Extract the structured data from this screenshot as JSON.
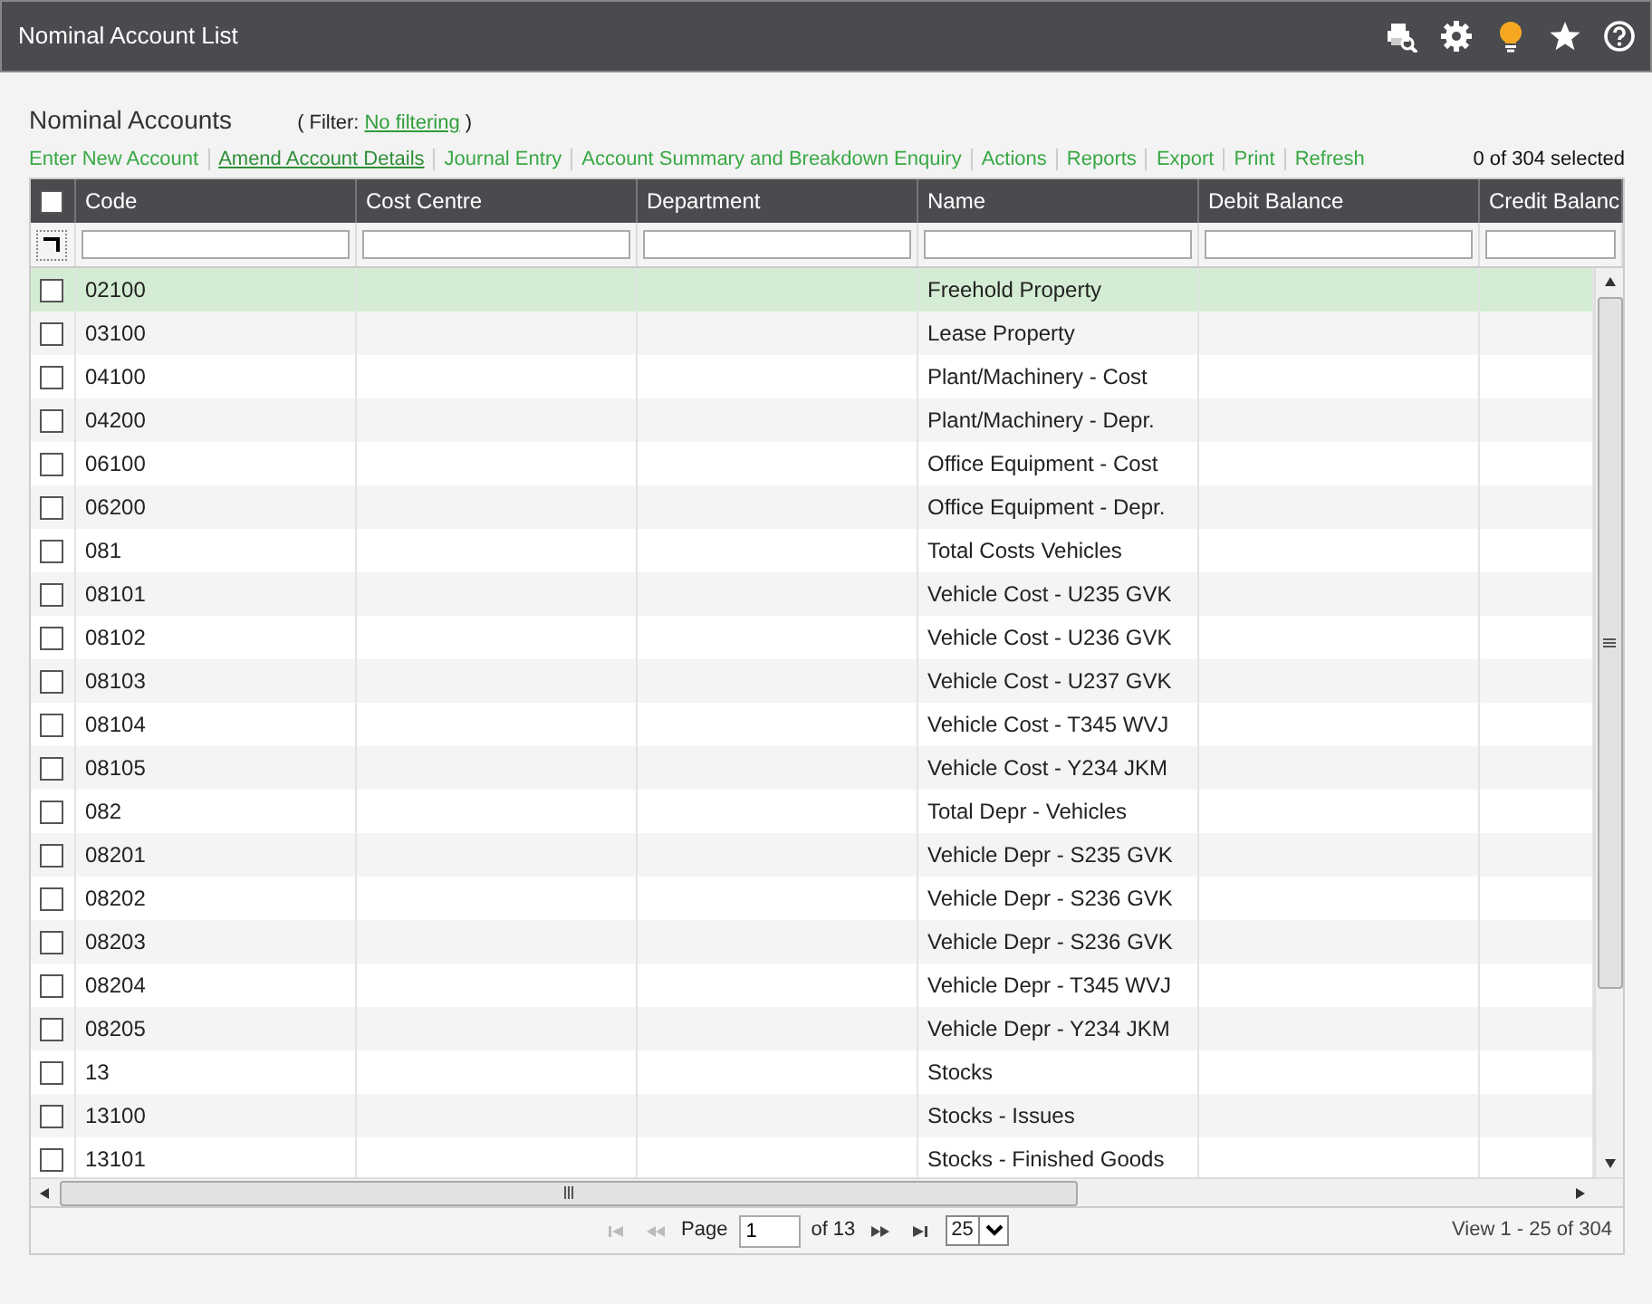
{
  "window": {
    "title": "Nominal Account List"
  },
  "heading": "Nominal Accounts",
  "filter": {
    "open": "(",
    "label": "Filter:",
    "value": "No filtering",
    "close": ")"
  },
  "toolbar": [
    {
      "label": "Enter New Account",
      "focused": false
    },
    {
      "label": "Amend Account Details",
      "focused": true
    },
    {
      "label": "Journal Entry",
      "focused": false
    },
    {
      "label": "Account Summary and Breakdown Enquiry",
      "focused": false
    },
    {
      "label": "Actions",
      "focused": false
    },
    {
      "label": "Reports",
      "focused": false
    },
    {
      "label": "Export",
      "focused": false
    },
    {
      "label": "Print",
      "focused": false
    },
    {
      "label": "Refresh",
      "focused": false
    }
  ],
  "selection_count": "0 of 304 selected",
  "table": {
    "select_all_checked": false,
    "columns": [
      "Code",
      "Cost Centre",
      "Department",
      "Name",
      "Debit Balance",
      "Credit Balanc"
    ],
    "rows": [
      {
        "checked": false,
        "highlighted": true,
        "cells": [
          "02100",
          "",
          "",
          "Freehold Property",
          "",
          ""
        ]
      },
      {
        "checked": false,
        "highlighted": false,
        "cells": [
          "03100",
          "",
          "",
          "Lease Property",
          "",
          ""
        ]
      },
      {
        "checked": false,
        "highlighted": false,
        "cells": [
          "04100",
          "",
          "",
          "Plant/Machinery - Cost",
          "",
          ""
        ]
      },
      {
        "checked": false,
        "highlighted": false,
        "cells": [
          "04200",
          "",
          "",
          "Plant/Machinery - Depr.",
          "",
          ""
        ]
      },
      {
        "checked": false,
        "highlighted": false,
        "cells": [
          "06100",
          "",
          "",
          "Office Equipment - Cost",
          "",
          ""
        ]
      },
      {
        "checked": false,
        "highlighted": false,
        "cells": [
          "06200",
          "",
          "",
          "Office Equipment - Depr.",
          "",
          ""
        ]
      },
      {
        "checked": false,
        "highlighted": false,
        "cells": [
          "081",
          "",
          "",
          "Total Costs Vehicles",
          "",
          ""
        ]
      },
      {
        "checked": false,
        "highlighted": false,
        "cells": [
          "08101",
          "",
          "",
          "Vehicle Cost - U235 GVK",
          "",
          ""
        ]
      },
      {
        "checked": false,
        "highlighted": false,
        "cells": [
          "08102",
          "",
          "",
          "Vehicle Cost - U236 GVK",
          "",
          ""
        ]
      },
      {
        "checked": false,
        "highlighted": false,
        "cells": [
          "08103",
          "",
          "",
          "Vehicle Cost - U237 GVK",
          "",
          ""
        ]
      },
      {
        "checked": false,
        "highlighted": false,
        "cells": [
          "08104",
          "",
          "",
          "Vehicle Cost - T345 WVJ",
          "",
          ""
        ]
      },
      {
        "checked": false,
        "highlighted": false,
        "cells": [
          "08105",
          "",
          "",
          "Vehicle Cost - Y234 JKM",
          "",
          ""
        ]
      },
      {
        "checked": false,
        "highlighted": false,
        "cells": [
          "082",
          "",
          "",
          "Total Depr - Vehicles",
          "",
          ""
        ]
      },
      {
        "checked": false,
        "highlighted": false,
        "cells": [
          "08201",
          "",
          "",
          "Vehicle Depr - S235 GVK",
          "",
          ""
        ]
      },
      {
        "checked": false,
        "highlighted": false,
        "cells": [
          "08202",
          "",
          "",
          "Vehicle Depr - S236 GVK",
          "",
          ""
        ]
      },
      {
        "checked": false,
        "highlighted": false,
        "cells": [
          "08203",
          "",
          "",
          "Vehicle Depr - S236 GVK",
          "",
          ""
        ]
      },
      {
        "checked": false,
        "highlighted": false,
        "cells": [
          "08204",
          "",
          "",
          "Vehicle Depr - T345 WVJ",
          "",
          ""
        ]
      },
      {
        "checked": false,
        "highlighted": false,
        "cells": [
          "08205",
          "",
          "",
          "Vehicle Depr - Y234 JKM",
          "",
          ""
        ]
      },
      {
        "checked": false,
        "highlighted": false,
        "cells": [
          "13",
          "",
          "",
          "Stocks",
          "",
          ""
        ]
      },
      {
        "checked": false,
        "highlighted": false,
        "cells": [
          "13100",
          "",
          "",
          "Stocks - Issues",
          "",
          ""
        ]
      },
      {
        "checked": false,
        "highlighted": false,
        "cells": [
          "13101",
          "",
          "",
          "Stocks - Finished Goods",
          "",
          ""
        ]
      }
    ]
  },
  "pager": {
    "first_disabled": true,
    "prev_disabled": true,
    "next_disabled": false,
    "last_disabled": false,
    "page_label": "Page",
    "page": "1",
    "of": "of 13",
    "page_size": "25",
    "view": "View 1 - 25 of 304"
  }
}
